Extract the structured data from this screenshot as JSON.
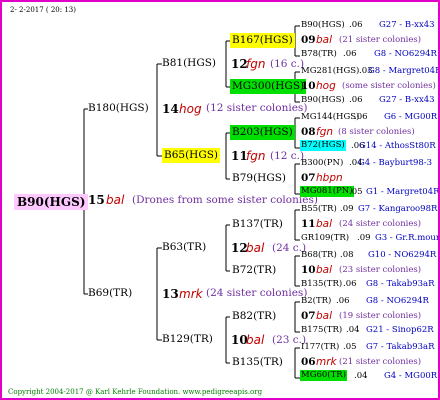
{
  "header": "2-  2-2017  ( 20: 13)",
  "footer": "Copyright 2004-2017 @ Karl Kehrle Foundation.   www.pedigreeapis.org",
  "root": {
    "id": "B90(HGS)",
    "num": "15",
    "name": "bal",
    "note": "(Drones from some sister colonies)"
  },
  "gen1": [
    {
      "id": "B180(HGS)",
      "num": "14",
      "name": "hog",
      "note": "(12 sister colonies)"
    },
    {
      "id": "B69(TR)",
      "num": "13",
      "name": "mrk",
      "note": "(24 sister colonies)"
    }
  ],
  "gen2": [
    {
      "id": "B81(HGS)",
      "num": "12",
      "name": "fgn",
      "note": "(16 c.)"
    },
    {
      "id": "B65(HGS)",
      "num": "11",
      "name": "fgn",
      "note": "(12 c.)"
    },
    {
      "id": "B63(TR)",
      "num": "12",
      "name": "bal",
      "note": "(24 c.)"
    },
    {
      "id": "B129(TR)",
      "num": "10",
      "name": "bal",
      "note": "(23 c.)"
    }
  ],
  "gen3": [
    {
      "id": "B167(HGS)"
    },
    {
      "id": "MG300(HGS)"
    },
    {
      "id": "B203(HGS)"
    },
    {
      "id": "B79(HGS)"
    },
    {
      "id": "B137(TR)"
    },
    {
      "id": "B72(TR)"
    },
    {
      "id": "B82(TR)"
    },
    {
      "id": "B135(TR)"
    }
  ],
  "gen4": [
    {
      "id": "B90(HGS)",
      "sep": ".06",
      "ref": "G27 - B-xx43"
    },
    {
      "num": "09",
      "name": "bal",
      "note": "(21 sister colonies)"
    },
    {
      "id": "B78(TR)",
      "sep": ".06",
      "ref": "G8 - NO6294R"
    },
    {
      "id": "MG281(HGS)",
      "sep": ".03",
      "ref": "G8 - Margret04R"
    },
    {
      "num": "10",
      "name": "hog",
      "note": "(some sister colonies)"
    },
    {
      "id": "B90(HGS)",
      "sep": ".06",
      "ref": "G27 - B-xx43"
    },
    {
      "id": "MG144(HGS)",
      "sep": ".06",
      "ref": "G6 - MG00R"
    },
    {
      "num": "08",
      "name": "fgn",
      "note": "(8 sister colonies)"
    },
    {
      "id": "B72(HGS)",
      "sep": ".06",
      "ref": "G14 - AthosSt80R"
    },
    {
      "id": "B300(PN)",
      "sep": ".04",
      "ref": "G4 - Bayburt98-3"
    },
    {
      "num": "07",
      "name": "hbpn",
      "note": ""
    },
    {
      "id": "MG081(PN)",
      "sep": ".05",
      "ref": "G1 - Margret04R"
    },
    {
      "id": "B55(TR)",
      "sep": ".09",
      "ref": "G7 - Kangaroo98R"
    },
    {
      "num": "11",
      "name": "bal",
      "note": "(24 sister colonies)"
    },
    {
      "id": "GR109(TR)",
      "sep": ".09",
      "ref": "G3 - Gr.R.mounta"
    },
    {
      "id": "B68(TR)",
      "sep": ".08",
      "ref": "G10 - NO6294R"
    },
    {
      "num": "10",
      "name": "bal",
      "note": "(23 sister colonies)"
    },
    {
      "id": "B135(TR)",
      "sep": ".06",
      "ref": "G8 - Takab93aR"
    },
    {
      "id": "B2(TR)",
      "sep": ".06",
      "ref": "G8 - NO6294R"
    },
    {
      "num": "07",
      "name": "bal",
      "note": "(19 sister colonies)"
    },
    {
      "id": "B175(TR)",
      "sep": ".04",
      "ref": "G21 - Sinop62R"
    },
    {
      "id": "I177(TR)",
      "sep": ".05",
      "ref": "G7 - Takab93aR"
    },
    {
      "num": "06",
      "name": "mrk",
      "note": "(21 sister colonies)"
    },
    {
      "id": "MG60(TR)",
      "sep": ".04",
      "ref": "G4 - MG00R"
    }
  ],
  "colors": {
    "frame": "#e000c8",
    "root_bg": "#ffc8ff",
    "highlight_yellow": "#ffff00",
    "highlight_green": "#00e000",
    "highlight_cyan": "#00ffff",
    "hbpn_color": "#c00000",
    "ref_color": "#0000c0"
  }
}
